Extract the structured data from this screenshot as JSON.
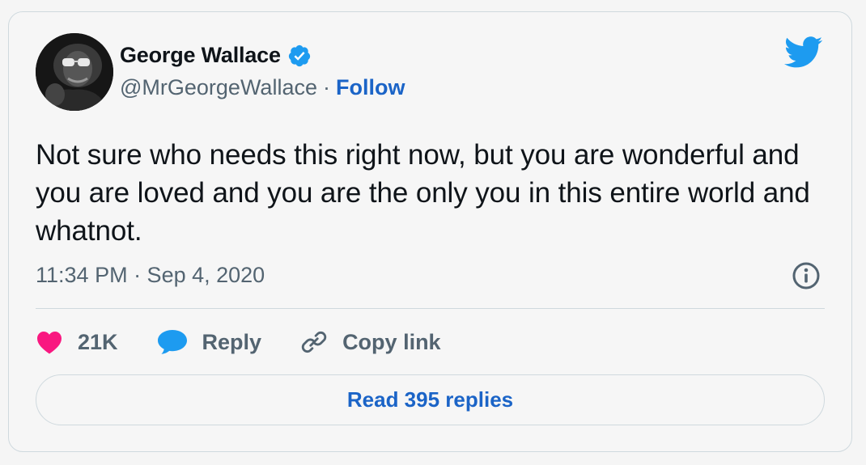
{
  "author": {
    "name": "George Wallace",
    "handle": "@MrGeorgeWallace",
    "separator": "·",
    "follow_label": "Follow",
    "verified": true
  },
  "tweet": {
    "text": "Not sure who needs this right now, but you are wonderful and you are loved and you are the only you in this entire world and whatnot.",
    "timestamp": "11:34 PM · Sep 4, 2020"
  },
  "actions": {
    "likes": "21K",
    "reply_label": "Reply",
    "copy_link_label": "Copy link"
  },
  "read_replies_label": "Read 395 replies",
  "colors": {
    "accent": "#1b64c7",
    "twitter_blue": "#1d9bf0",
    "like_pink": "#f91880",
    "muted_text": "#536471",
    "border": "#cfd9de"
  },
  "icons": [
    "twitter-bird-icon",
    "verified-badge-icon",
    "info-icon",
    "heart-icon",
    "reply-bubble-icon",
    "link-icon"
  ]
}
